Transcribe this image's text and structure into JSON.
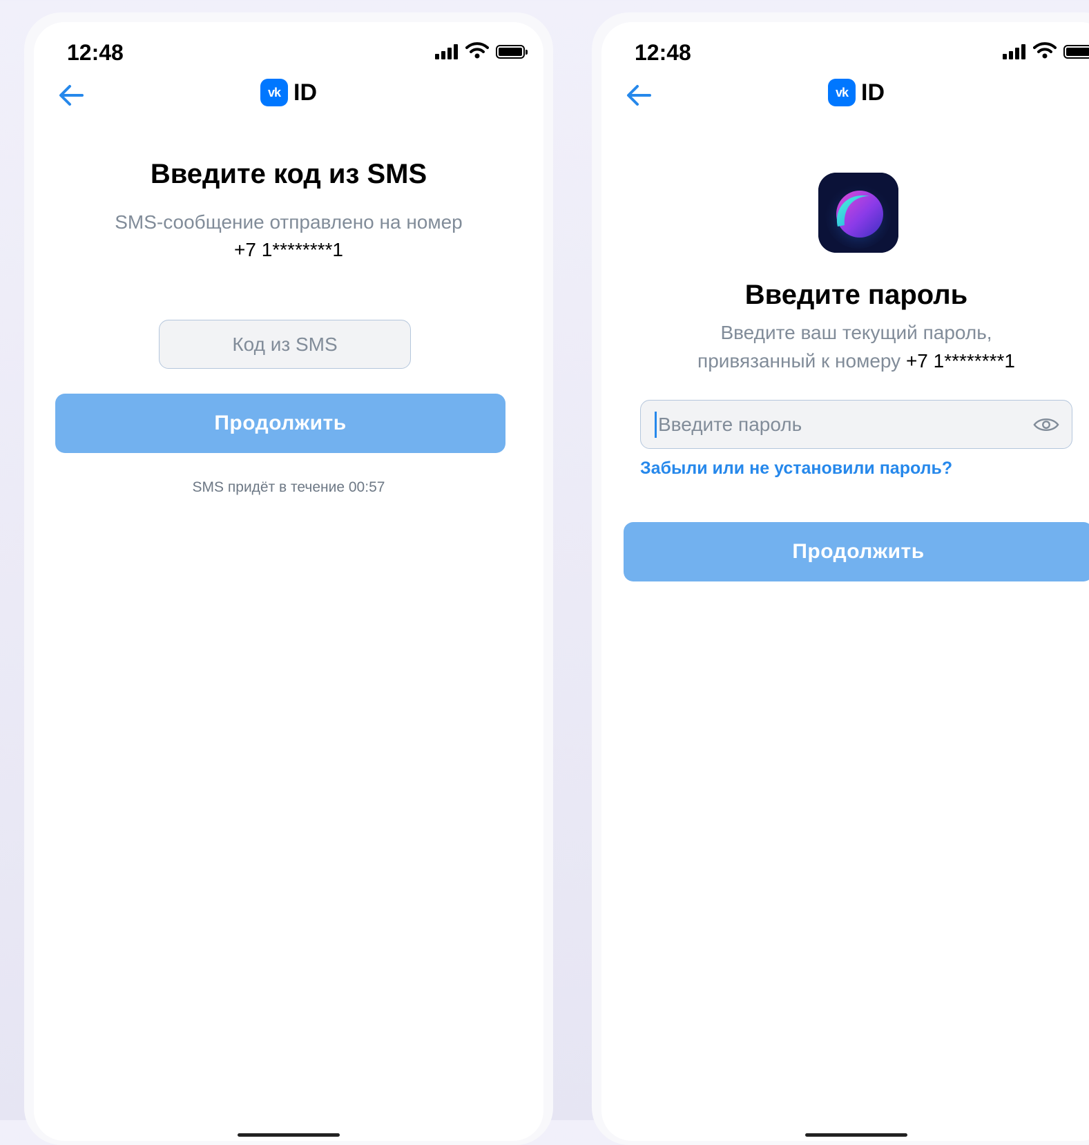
{
  "screens": [
    {
      "status_time": "12:48",
      "logo_badge": "vk",
      "logo_text": "ID",
      "title": "Введите код из SMS",
      "subtitle_line1": "SMS-сообщение отправлено на номер",
      "phone": "+7 1********1",
      "input_placeholder": "Код из SMS",
      "continue_label": "Продолжить",
      "timer_text": "SMS придёт в течение 00:57"
    },
    {
      "status_time": "12:48",
      "logo_badge": "vk",
      "logo_text": "ID",
      "title": "Введите пароль",
      "subtitle_line1": "Введите ваш текущий пароль,",
      "subtitle_line2_prefix": "привязанный к номеру",
      "phone": "+7 1********1",
      "input_placeholder": "Введите пароль",
      "forgot_link": "Забыли или не установили пароль?",
      "continue_label": "Продолжить"
    }
  ],
  "icons": {
    "back": "arrow-left-icon",
    "signal": "cellular-signal-icon",
    "wifi": "wifi-icon",
    "battery": "battery-icon",
    "eye": "eye-icon",
    "app": "app-logo-icon"
  },
  "colors": {
    "accent": "#2688eb",
    "button": "#72b1ef",
    "vk_blue": "#0077ff",
    "secondary_text": "#818c99",
    "input_bg": "#f2f3f5"
  }
}
